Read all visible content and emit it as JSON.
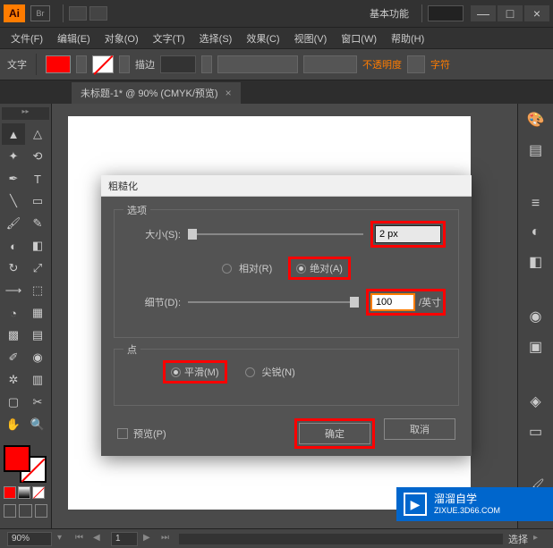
{
  "titlebar": {
    "workspace": "基本功能"
  },
  "menu": {
    "file": "文件(F)",
    "edit": "编辑(E)",
    "object": "对象(O)",
    "text": "文字(T)",
    "select": "选择(S)",
    "effect": "效果(C)",
    "view": "视图(V)",
    "window": "窗口(W)",
    "help": "帮助(H)"
  },
  "controlbar": {
    "label_text": "文字",
    "label_stroke": "描边",
    "opacity": "不透明度",
    "character": "字符"
  },
  "doctab": {
    "title": "未标题-1* @ 90% (CMYK/预览)"
  },
  "dialog": {
    "title": "粗糙化",
    "options_legend": "选项",
    "size_label": "大小(S):",
    "size_value": "2 px",
    "relative": "相对(R)",
    "absolute": "绝对(A)",
    "detail_label": "细节(D):",
    "detail_value": "100",
    "detail_unit": "/英寸",
    "points_legend": "点",
    "smooth": "平滑(M)",
    "corner": "尖锐(N)",
    "preview": "预览(P)",
    "ok": "确定",
    "cancel": "取消"
  },
  "statusbar": {
    "zoom": "90%",
    "tool": "选择"
  },
  "watermark": {
    "name": "溜溜自学",
    "url": "ZIXUE.3D66.COM"
  }
}
